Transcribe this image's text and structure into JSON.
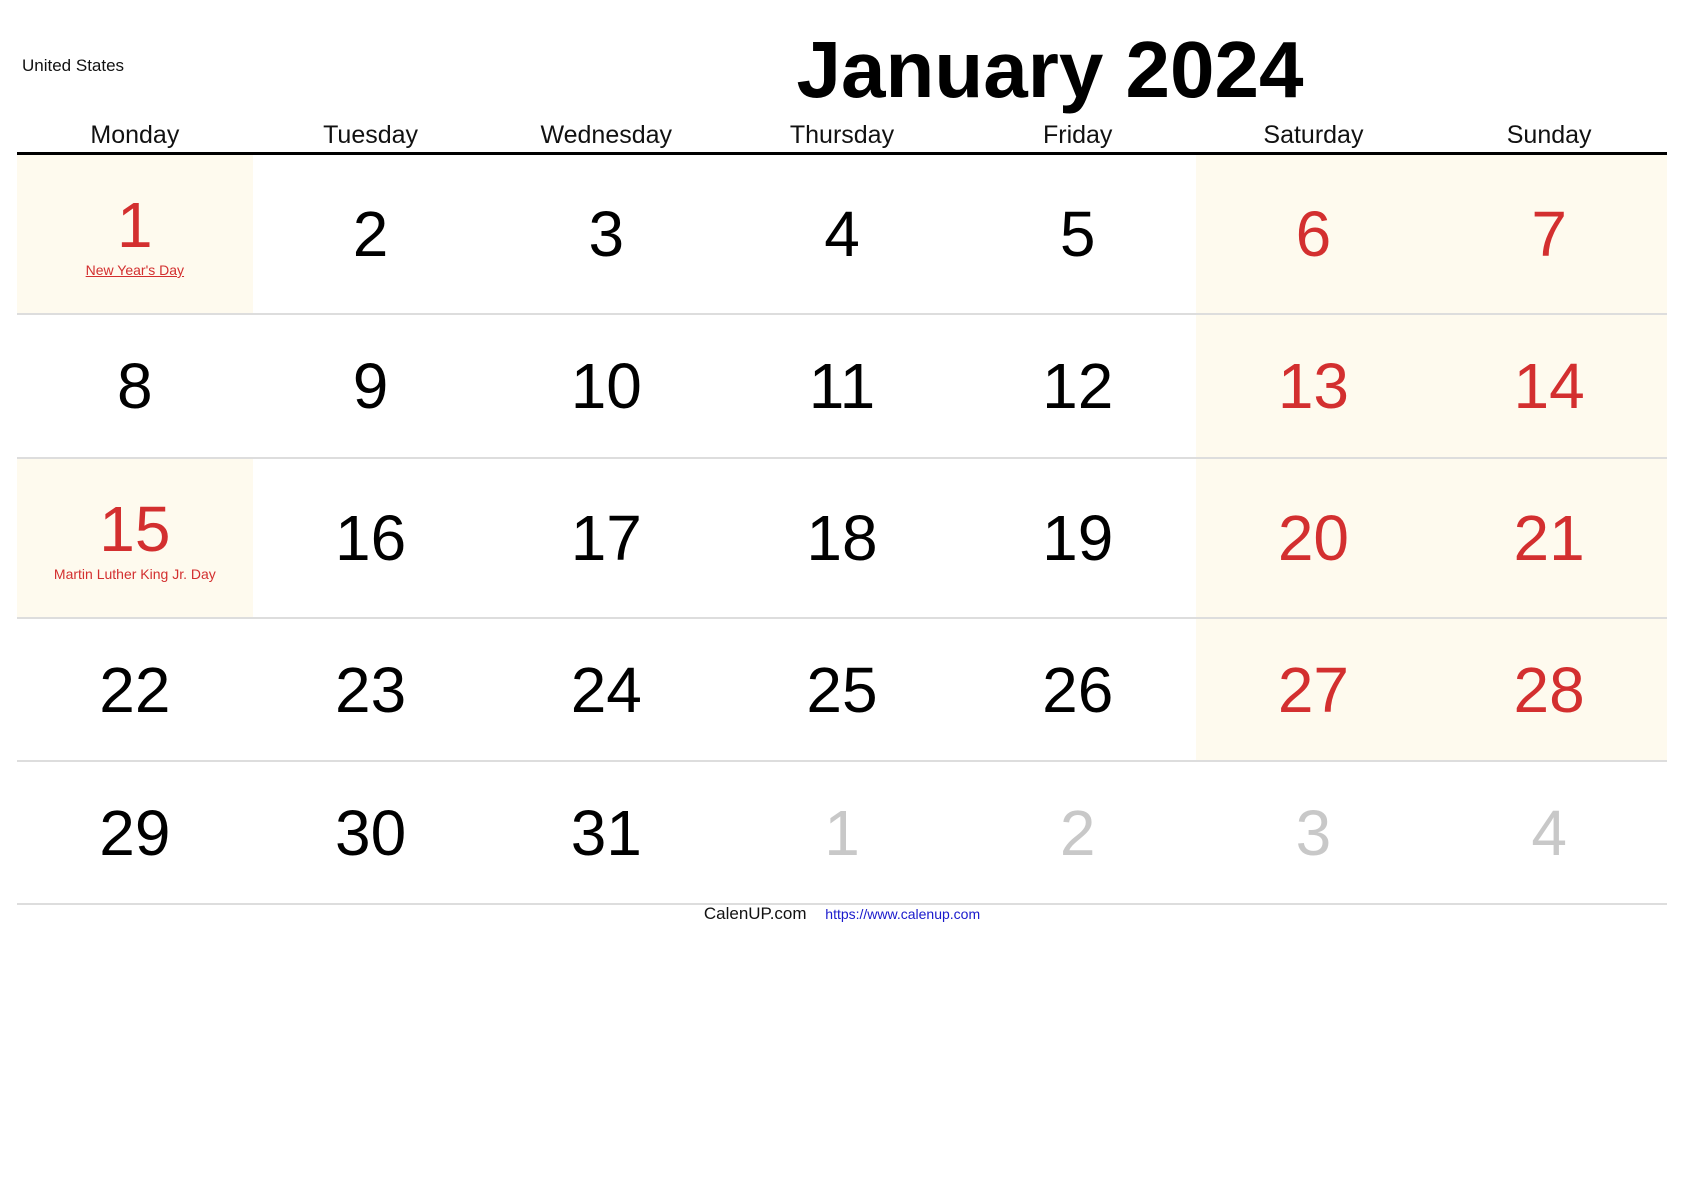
{
  "country": "United States",
  "title": "January 2024",
  "weekdays": [
    "Monday",
    "Tuesday",
    "Wednesday",
    "Thursday",
    "Friday",
    "Saturday",
    "Sunday"
  ],
  "colors": {
    "holiday_red": "#d32f2f",
    "weekend_bg": "#fefaee",
    "muted": "#c8c8c8",
    "link_blue": "#1a1acc"
  },
  "weeks": [
    [
      {
        "day": "1",
        "type": "holiday",
        "holiday": "New Year's Day",
        "holiday_link": true
      },
      {
        "day": "2",
        "type": "normal"
      },
      {
        "day": "3",
        "type": "normal"
      },
      {
        "day": "4",
        "type": "normal"
      },
      {
        "day": "5",
        "type": "normal"
      },
      {
        "day": "6",
        "type": "weekend"
      },
      {
        "day": "7",
        "type": "weekend"
      }
    ],
    [
      {
        "day": "8",
        "type": "normal"
      },
      {
        "day": "9",
        "type": "normal"
      },
      {
        "day": "10",
        "type": "normal"
      },
      {
        "day": "11",
        "type": "normal"
      },
      {
        "day": "12",
        "type": "normal"
      },
      {
        "day": "13",
        "type": "weekend"
      },
      {
        "day": "14",
        "type": "weekend"
      }
    ],
    [
      {
        "day": "15",
        "type": "holiday",
        "holiday": "Martin Luther King Jr. Day",
        "holiday_link": false
      },
      {
        "day": "16",
        "type": "normal"
      },
      {
        "day": "17",
        "type": "normal"
      },
      {
        "day": "18",
        "type": "normal"
      },
      {
        "day": "19",
        "type": "normal"
      },
      {
        "day": "20",
        "type": "weekend"
      },
      {
        "day": "21",
        "type": "weekend"
      }
    ],
    [
      {
        "day": "22",
        "type": "normal"
      },
      {
        "day": "23",
        "type": "normal"
      },
      {
        "day": "24",
        "type": "normal"
      },
      {
        "day": "25",
        "type": "normal"
      },
      {
        "day": "26",
        "type": "normal"
      },
      {
        "day": "27",
        "type": "weekend"
      },
      {
        "day": "28",
        "type": "weekend"
      }
    ],
    [
      {
        "day": "29",
        "type": "normal"
      },
      {
        "day": "30",
        "type": "normal"
      },
      {
        "day": "31",
        "type": "normal"
      },
      {
        "day": "1",
        "type": "other-month"
      },
      {
        "day": "2",
        "type": "other-month"
      },
      {
        "day": "3",
        "type": "other-month"
      },
      {
        "day": "4",
        "type": "other-month"
      }
    ]
  ],
  "footer": {
    "site": "CalenUP.com",
    "url": "https://www.calenup.com"
  }
}
